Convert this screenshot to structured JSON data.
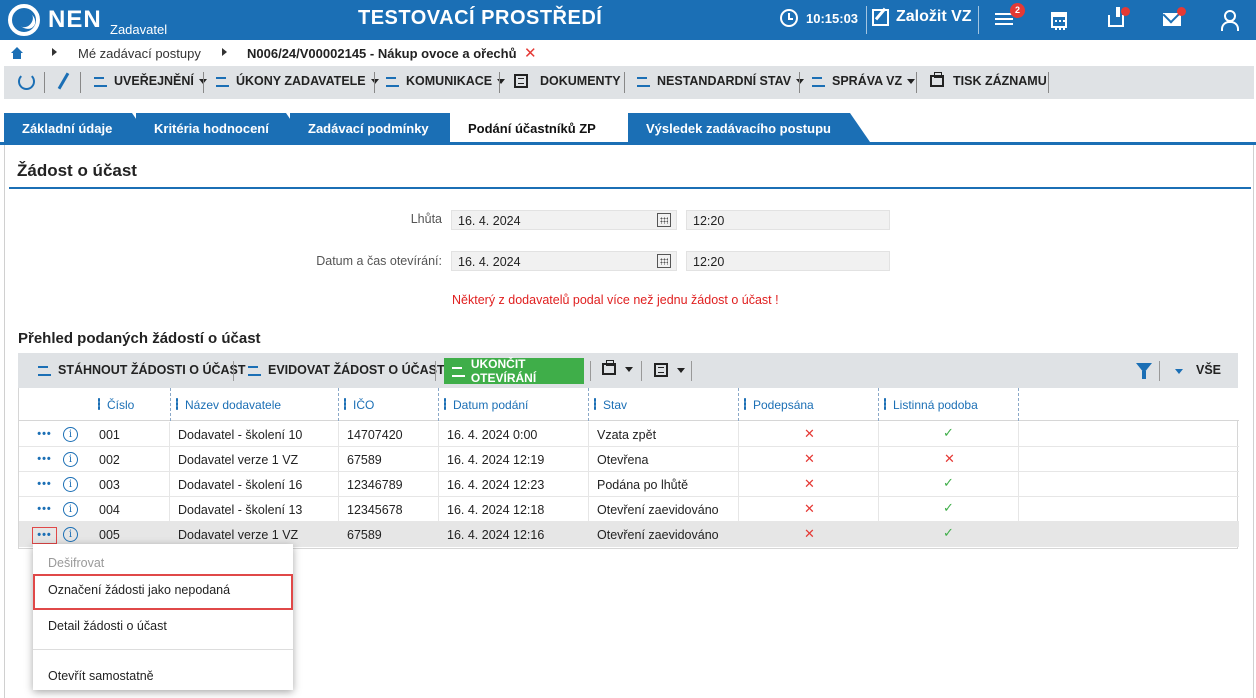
{
  "header": {
    "logo_text": "NEN",
    "logo_sub": "Zadavatel",
    "environment_title": "TESTOVACÍ PROSTŘEDÍ",
    "clock": "10:15:03",
    "create_label": "Založit VZ",
    "menu_badge": "2"
  },
  "breadcrumb": {
    "item1": "Mé zadávací postupy",
    "item2": "N006/24/V00002145 - Nákup ovoce a ořechů",
    "close": "✕"
  },
  "toolbar": {
    "uverejneni": "UVEŘEJNĚNÍ",
    "ukony": "ÚKONY ZADAVATELE",
    "komunikace": "KOMUNIKACE",
    "dokumenty": "DOKUMENTY",
    "nestandardni": "NESTANDARDNÍ STAV",
    "sprava": "SPRÁVA VZ",
    "tisk": "TISK ZÁZNAMU"
  },
  "tabs": [
    {
      "label": "Základní údaje"
    },
    {
      "label": "Kritéria hodnocení"
    },
    {
      "label": "Zadávací podmínky"
    },
    {
      "label": "Podání účastníků ZP"
    },
    {
      "label": "Výsledek zadávacího postupu"
    }
  ],
  "panel": {
    "title": "Žádost o účast",
    "lhuta_label": "Lhůta",
    "lhuta_date": "16. 4. 2024",
    "lhuta_time": "12:20",
    "otevirani_label": "Datum a čas otevírání:",
    "otevirani_date": "16. 4. 2024",
    "otevirani_time": "12:20",
    "warning": "Některý z dodavatelů podal více než jednu žádost o účast !"
  },
  "overview": {
    "title": "Přehled podaných žádostí o účast",
    "btn_download": "STÁHNOUT ŽÁDOSTI O ÚČAST",
    "btn_record": "EVIDOVAT ŽÁDOST O ÚČAST",
    "btn_finish": "UKONČIT OTEVÍRÁNÍ",
    "btn_all": "VŠE"
  },
  "table": {
    "columns": [
      "Číslo",
      "Název dodavatele",
      "IČO",
      "Datum podání",
      "Stav",
      "Podepsána",
      "Listinná podoba"
    ],
    "rows": [
      {
        "cislo": "001",
        "nazev": "Dodavatel - školení 10",
        "ico": "14707420",
        "datum": "16. 4. 2024 0:00",
        "stav": "Vzata zpět",
        "podepsana": false,
        "listinna": true
      },
      {
        "cislo": "002",
        "nazev": "Dodavatel verze 1 VZ",
        "ico": "67589",
        "datum": "16. 4. 2024 12:19",
        "stav": "Otevřena",
        "podepsana": false,
        "listinna": false
      },
      {
        "cislo": "003",
        "nazev": "Dodavatel - školení 16",
        "ico": "12346789",
        "datum": "16. 4. 2024 12:23",
        "stav": "Podána po lhůtě",
        "podepsana": false,
        "listinna": true
      },
      {
        "cislo": "004",
        "nazev": "Dodavatel - školení 13",
        "ico": "12345678",
        "datum": "16. 4. 2024 12:18",
        "stav": "Otevření zaevidováno",
        "podepsana": false,
        "listinna": true
      },
      {
        "cislo": "005",
        "nazev": "Dodavatel verze 1 VZ",
        "ico": "67589",
        "datum": "16. 4. 2024 12:16",
        "stav": "Otevření zaevidováno",
        "podepsana": false,
        "listinna": true
      }
    ]
  },
  "context_menu": {
    "item1": "Dešifrovat",
    "item2": "Označení žádosti jako nepodaná",
    "item3": "Detail žádosti o účast",
    "item4": "Otevřít samostatně"
  },
  "colors": {
    "brand": "#1b6fb5",
    "success": "#3fae49",
    "danger": "#e53935"
  }
}
